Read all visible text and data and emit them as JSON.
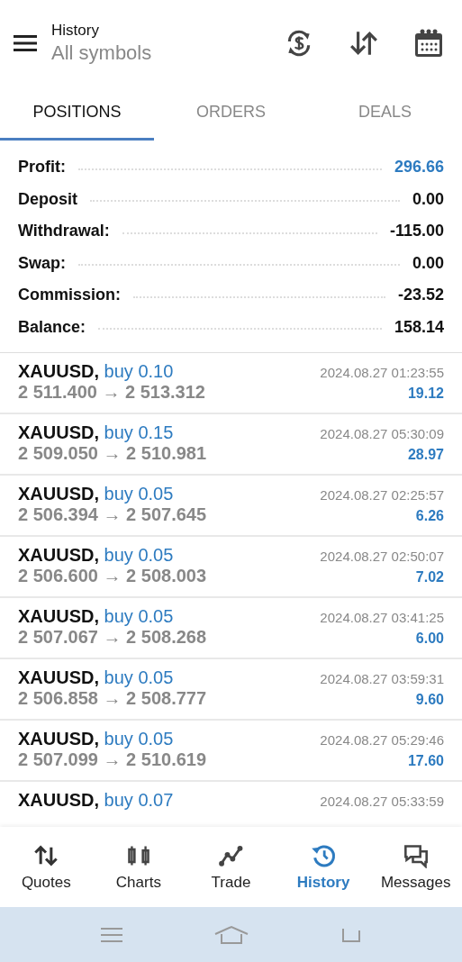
{
  "header": {
    "title": "History",
    "subtitle": "All symbols"
  },
  "tabs": [
    {
      "label": "POSITIONS",
      "selected": true
    },
    {
      "label": "ORDERS",
      "selected": false
    },
    {
      "label": "DEALS",
      "selected": false
    }
  ],
  "summary": [
    {
      "label": "Profit:",
      "value": "296.66",
      "kind": "highlight"
    },
    {
      "label": "Deposit",
      "value": "0.00",
      "kind": "plain"
    },
    {
      "label": "Withdrawal:",
      "value": "-115.00",
      "kind": "plain"
    },
    {
      "label": "Swap:",
      "value": "0.00",
      "kind": "plain"
    },
    {
      "label": "Commission:",
      "value": "-23.52",
      "kind": "plain"
    },
    {
      "label": "Balance:",
      "value": "158.14",
      "kind": "plain"
    }
  ],
  "positions": [
    {
      "symbol": "XAUUSD,",
      "side": "buy 0.10",
      "time": "2024.08.27 01:23:55",
      "prices": "2 511.400 → 2 513.312",
      "profit": "19.12"
    },
    {
      "symbol": "XAUUSD,",
      "side": "buy 0.15",
      "time": "2024.08.27 05:30:09",
      "prices": "2 509.050 → 2 510.981",
      "profit": "28.97"
    },
    {
      "symbol": "XAUUSD,",
      "side": "buy 0.05",
      "time": "2024.08.27 02:25:57",
      "prices": "2 506.394 → 2 507.645",
      "profit": "6.26"
    },
    {
      "symbol": "XAUUSD,",
      "side": "buy 0.05",
      "time": "2024.08.27 02:50:07",
      "prices": "2 506.600 → 2 508.003",
      "profit": "7.02"
    },
    {
      "symbol": "XAUUSD,",
      "side": "buy 0.05",
      "time": "2024.08.27 03:41:25",
      "prices": "2 507.067 → 2 508.268",
      "profit": "6.00"
    },
    {
      "symbol": "XAUUSD,",
      "side": "buy 0.05",
      "time": "2024.08.27 03:59:31",
      "prices": "2 506.858 → 2 508.777",
      "profit": "9.60"
    },
    {
      "symbol": "XAUUSD,",
      "side": "buy 0.05",
      "time": "2024.08.27 05:29:46",
      "prices": "2 507.099 → 2 510.619",
      "profit": "17.60"
    },
    {
      "symbol": "XAUUSD,",
      "side": "buy 0.07",
      "time": "2024.08.27 05:33:59"
    }
  ],
  "nav": [
    {
      "label": "Quotes",
      "kind": "quotes",
      "selected": false
    },
    {
      "label": "Charts",
      "kind": "charts",
      "selected": false
    },
    {
      "label": "Trade",
      "kind": "trade",
      "selected": false
    },
    {
      "label": "History",
      "kind": "history",
      "selected": true
    },
    {
      "label": "Messages",
      "kind": "messages",
      "selected": false
    }
  ]
}
